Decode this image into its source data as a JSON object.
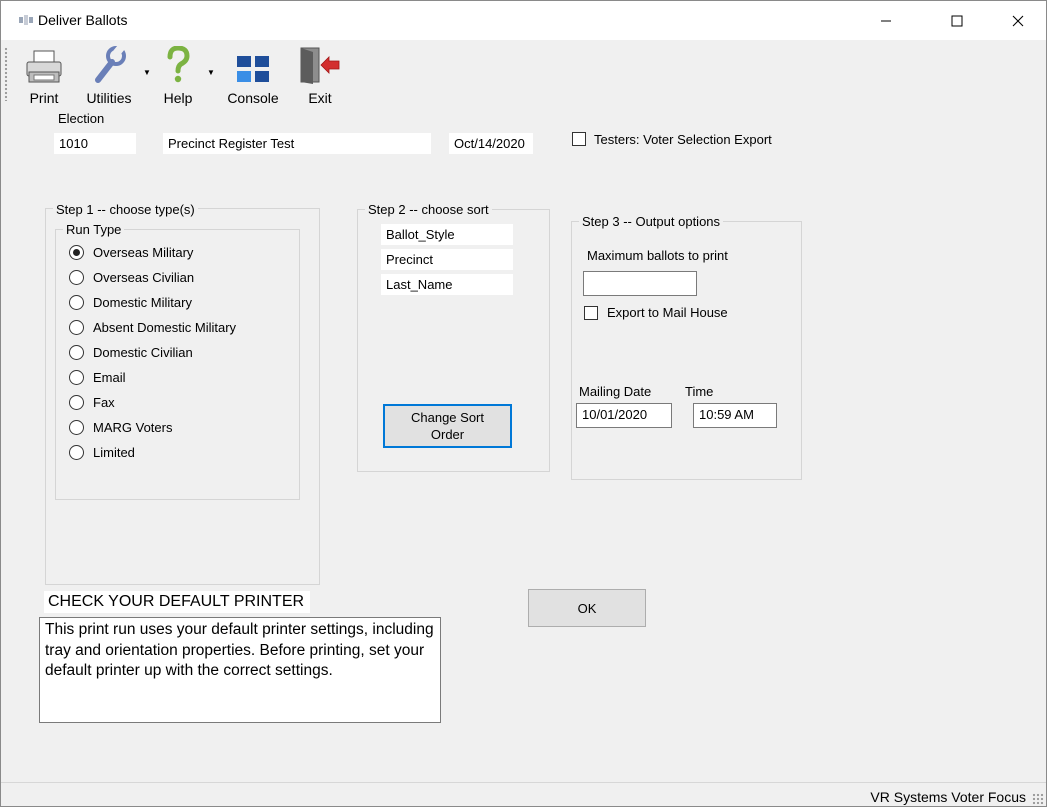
{
  "window": {
    "title": "Deliver Ballots",
    "icon": "app-icon",
    "controls": [
      "minimize-icon",
      "maximize-icon",
      "close-icon"
    ]
  },
  "toolbar": {
    "items": [
      {
        "label": "Print",
        "icon": "printer-icon"
      },
      {
        "label": "Utilities",
        "icon": "wrench-icon"
      },
      {
        "label": "Help",
        "icon": "help-question-icon"
      },
      {
        "label": "Console",
        "icon": "console-grid-icon"
      },
      {
        "label": "Exit",
        "icon": "exit-door-icon"
      }
    ]
  },
  "election": {
    "label": "Election",
    "number": "1010",
    "name": "Precinct Register Test",
    "date": "Oct/14/2020"
  },
  "testers_checkbox": {
    "label": "Testers: Voter Selection Export",
    "checked": false
  },
  "step1": {
    "title": "Step 1 -- choose type(s)",
    "run_type_label": "Run Type",
    "options": [
      {
        "label": "Overseas Military",
        "selected": true
      },
      {
        "label": "Overseas Civilian",
        "selected": false
      },
      {
        "label": "Domestic Military",
        "selected": false
      },
      {
        "label": "Absent Domestic Military",
        "selected": false
      },
      {
        "label": "Domestic Civilian",
        "selected": false
      },
      {
        "label": "Email",
        "selected": false
      },
      {
        "label": "Fax",
        "selected": false
      },
      {
        "label": "MARG Voters",
        "selected": false
      },
      {
        "label": "Limited",
        "selected": false
      }
    ]
  },
  "step2": {
    "title": "Step 2 -- choose sort",
    "sort_fields": [
      "Ballot_Style",
      "Precinct",
      "Last_Name"
    ],
    "change_sort_label_line1": "Change Sort",
    "change_sort_label_line2": "Order"
  },
  "step3": {
    "title": "Step 3 -- Output options",
    "max_ballots_label": "Maximum ballots to print",
    "max_ballots_value": "",
    "export_mail_house_label": "Export to Mail House",
    "export_mail_house_checked": false,
    "mailing_date_label": "Mailing Date",
    "mailing_date_value": "10/01/2020",
    "time_label": "Time",
    "time_value": "10:59 AM"
  },
  "ok_label": "OK",
  "notice": {
    "title": "CHECK YOUR DEFAULT PRINTER",
    "body": "This print run uses your default printer settings, including tray and orientation properties.  Before printing, set your default printer up with the correct settings."
  },
  "status": {
    "text": "VR Systems Voter Focus"
  }
}
